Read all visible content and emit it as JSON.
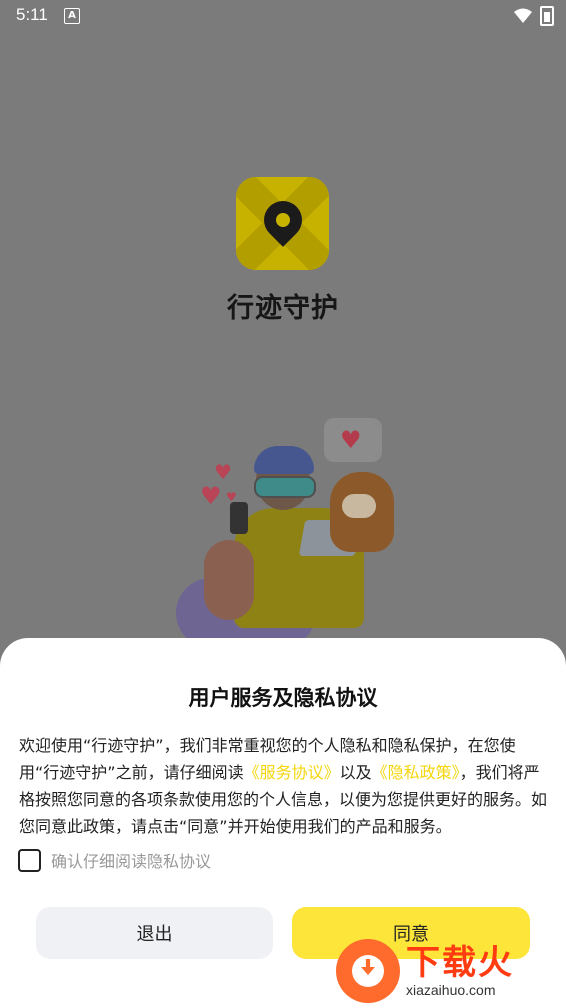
{
  "status_bar": {
    "time": "5:11",
    "notification_letter": "A"
  },
  "app": {
    "name": "行迹守护"
  },
  "dialog": {
    "title": "用户服务及隐私协议",
    "text_part1": "欢迎使用“行迹守护”，我们非常重视您的个人隐私和隐私保护，在您使用“行迹守护”之前，请仔细阅读",
    "link_service": "《服务协议》",
    "text_part2": "以及",
    "link_privacy": "《隐私政策》",
    "text_part3": "，我们将严格按照您同意的各项条款使用您的个人信息，以便为您提供更好的服务。如您同意此政策，请点击“同意”并开始使用我们的产品和服务。",
    "checkbox_label": "确认仔细阅读隐私协议",
    "exit_label": "退出",
    "agree_label": "同意"
  },
  "watermark": {
    "main": "下载火",
    "sub": "xiazaihuo.com"
  },
  "colors": {
    "accent_yellow": "#fde53a",
    "link_yellow": "#f4d60c",
    "watermark_orange": "#ff3b12"
  },
  "icons": [
    "wifi-icon",
    "battery-icon",
    "location-pin-icon",
    "heart-icon",
    "download-icon"
  ]
}
